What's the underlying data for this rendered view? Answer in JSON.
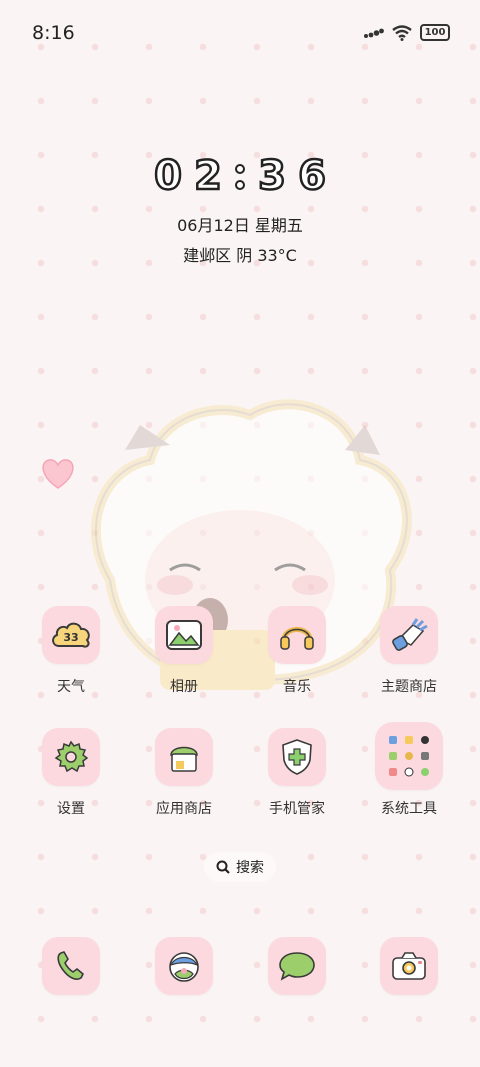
{
  "status_bar": {
    "time": "8:16",
    "battery": "100"
  },
  "clock": {
    "digits": [
      "0",
      "2",
      "3",
      "6"
    ],
    "date": "06月12日 星期五",
    "weather": "建邺区 阴 33°C"
  },
  "apps_row1": [
    {
      "label": "天气",
      "icon": "weather-cloud-icon",
      "icon_text": "33"
    },
    {
      "label": "相册",
      "icon": "gallery-icon"
    },
    {
      "label": "音乐",
      "icon": "headphones-icon"
    },
    {
      "label": "主题商店",
      "icon": "theme-brush-icon"
    }
  ],
  "apps_row2": [
    {
      "label": "设置",
      "icon": "gear-icon"
    },
    {
      "label": "应用商店",
      "icon": "app-store-icon"
    },
    {
      "label": "手机管家",
      "icon": "security-shield-icon"
    },
    {
      "label": "系统工具",
      "icon": "system-tools-folder-icon"
    }
  ],
  "search": {
    "label": "搜索"
  },
  "dock": [
    {
      "name": "phone",
      "icon": "phone-icon"
    },
    {
      "name": "browser",
      "icon": "browser-icon"
    },
    {
      "name": "messages",
      "icon": "message-icon"
    },
    {
      "name": "camera",
      "icon": "camera-icon"
    }
  ],
  "colors": {
    "tile": "#fbd9df",
    "green": "#8ccf6e",
    "background": "#fbf4f4"
  }
}
